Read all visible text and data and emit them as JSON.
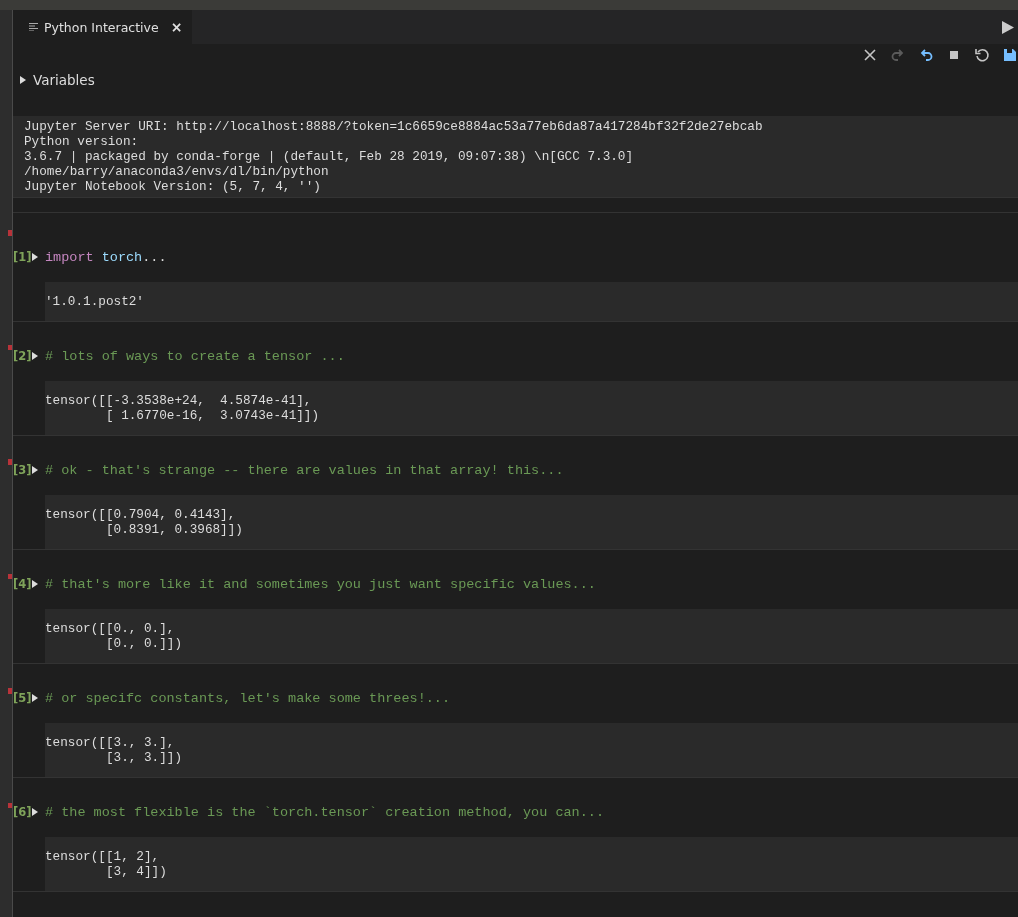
{
  "tab": {
    "title": "Python Interactive",
    "close": "×",
    "selected": true
  },
  "toolbar": [
    {
      "kind": "clear",
      "disabled": false
    },
    {
      "kind": "redo",
      "disabled": true
    },
    {
      "kind": "undo",
      "disabled": false
    },
    {
      "kind": "stop",
      "disabled": false
    },
    {
      "kind": "restart",
      "disabled": false
    },
    {
      "kind": "save",
      "disabled": false
    }
  ],
  "variables": {
    "label": "Variables",
    "expanded": false
  },
  "sys_info": [
    "Jupyter Server URI: http://localhost:8888/?token=1c6659ce8884ac53a77eb6da87a417284bf32f2de27ebcab",
    "Python version:",
    "3.6.7 | packaged by conda-forge | (default, Feb 28 2019, 09:07:38) \\n[GCC 7.3.0]",
    "/home/barry/anaconda3/envs/dl/bin/python",
    "Jupyter Notebook Version: (5, 7, 4, '')"
  ],
  "cells": [
    {
      "prompt": "[1]",
      "expanded": false,
      "code": [
        {
          "kind": "keyword",
          "text": "import"
        },
        {
          "kind": "name",
          "text": " torch"
        },
        {
          "kind": "plain",
          "text": "..."
        }
      ],
      "output": [
        "'1.0.1.post2'"
      ]
    },
    {
      "prompt": "[2]",
      "expanded": false,
      "code": [
        {
          "kind": "comment",
          "text": "# lots of ways to create a tensor ..."
        }
      ],
      "output": [
        "tensor([[-3.3538e+24,  4.5874e-41],",
        "        [ 1.6770e-16,  3.0743e-41]])"
      ]
    },
    {
      "prompt": "[3]",
      "expanded": false,
      "code": [
        {
          "kind": "comment",
          "text": "# ok - that's strange -- there are values in that array! this..."
        }
      ],
      "output": [
        "tensor([[0.7904, 0.4143],",
        "        [0.8391, 0.3968]])"
      ]
    },
    {
      "prompt": "[4]",
      "expanded": false,
      "code": [
        {
          "kind": "comment",
          "text": "# that's more like it and sometimes you just want specific values..."
        }
      ],
      "output": [
        "tensor([[0., 0.],",
        "        [0., 0.]])"
      ]
    },
    {
      "prompt": "[5]",
      "expanded": false,
      "code": [
        {
          "kind": "comment",
          "text": "# or specifc constants, let's make some threes!..."
        }
      ],
      "output": [
        "tensor([[3., 3.],",
        "        [3., 3.]])"
      ]
    },
    {
      "prompt": "[6]",
      "expanded": false,
      "code": [
        {
          "kind": "comment",
          "text": "# the most flexible is the `torch.tensor` creation method, you can..."
        }
      ],
      "output": [
        "tensor([[1, 2],",
        "        [3, 4]])"
      ]
    }
  ]
}
